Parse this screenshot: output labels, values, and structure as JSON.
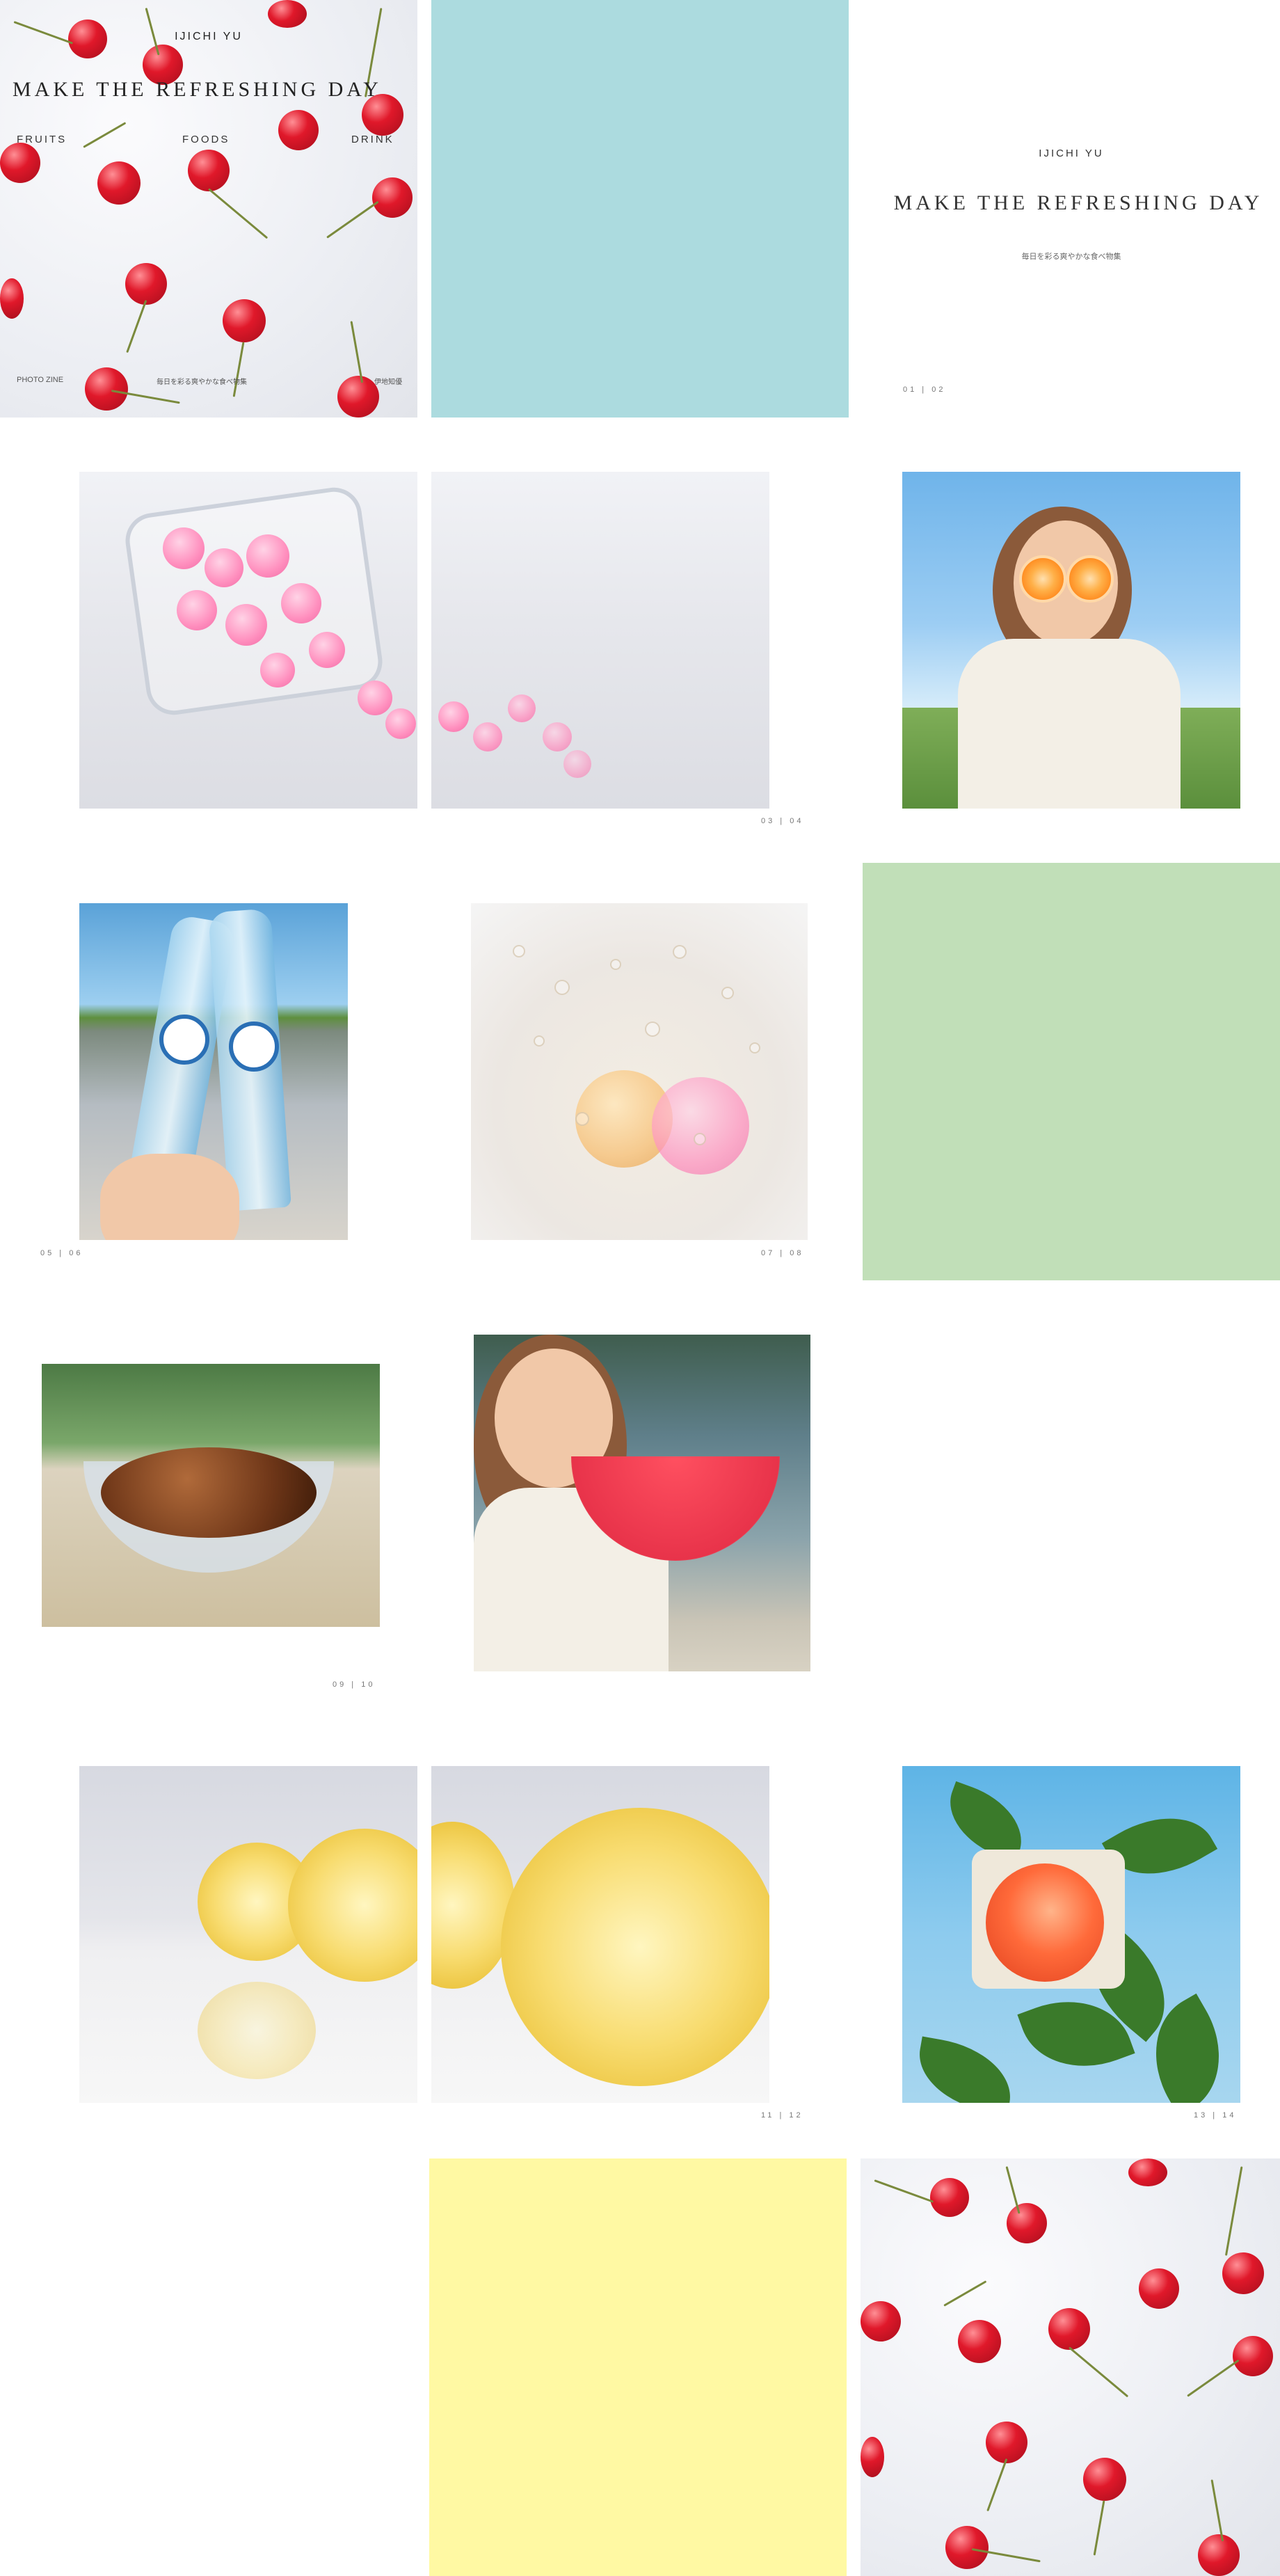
{
  "cover": {
    "author": "IJICHI YU",
    "title": "MAKE THE REFRESHING DAY",
    "categories": [
      "FRUITS",
      "FOODS",
      "DRINK"
    ],
    "publisher": "PHOTO ZINE",
    "subtitle_jp": "毎日を彩る爽やかな食べ物集",
    "author_jp": "伊地知優"
  },
  "title_page": {
    "author": "IJICHI YU",
    "title": "MAKE THE REFRESHING DAY",
    "subtitle_jp": "毎日を彩る爽やかな食べ物集",
    "page_numbers": "01 | 02"
  },
  "page_numbers": {
    "p03_04": "03 | 04",
    "p05_06": "05 | 06",
    "p07_08": "07 | 08",
    "p09_10": "09 | 10",
    "p11_12": "11 | 12",
    "p13_14": "13 | 14"
  },
  "colors": {
    "blue_panel": "#acdbdf",
    "green_panel": "#c1dfb8",
    "yellow_panel": "#fff9a3",
    "background": "#ffffff",
    "text": "#333333"
  }
}
